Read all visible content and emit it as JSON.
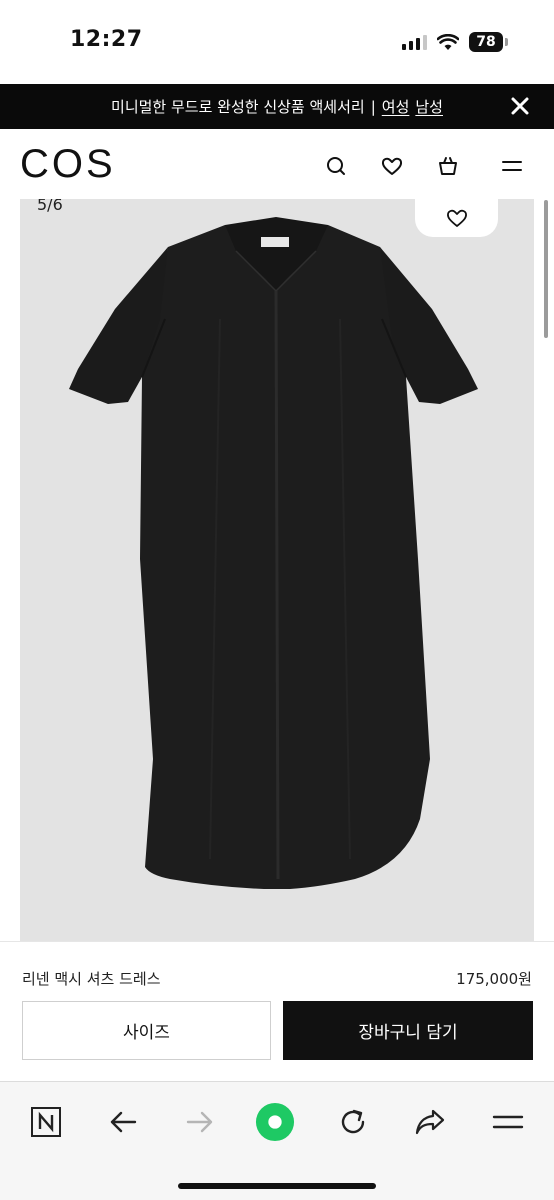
{
  "status_bar": {
    "time": "12:27",
    "battery": "78"
  },
  "promo": {
    "text": "미니멀한 무드로 완성한 신상품 액세서리",
    "separator": "|",
    "link_women": "여성",
    "link_men": "남성"
  },
  "header": {
    "logo": "COS",
    "icons": [
      "search-icon",
      "heart-icon",
      "shopping-bag-icon",
      "menu-icon"
    ]
  },
  "gallery": {
    "counter": "5/6"
  },
  "product": {
    "name": "리넨 맥시 셔츠 드레스",
    "price": "175,000원",
    "size_label": "사이즈",
    "cart_label": "장바구니 담기"
  },
  "browser_toolbar": {
    "icons": [
      "naver-n-icon",
      "back-arrow-icon",
      "forward-arrow-icon",
      "green-circle-icon",
      "reload-icon",
      "share-icon",
      "menu-icon"
    ]
  },
  "colors": {
    "promo_bg": "#0a0a0a",
    "image_bg": "#e3e3e3",
    "dress": "#1d1d1d",
    "cart_button_bg": "#111111",
    "accent_green": "#1ec964"
  }
}
